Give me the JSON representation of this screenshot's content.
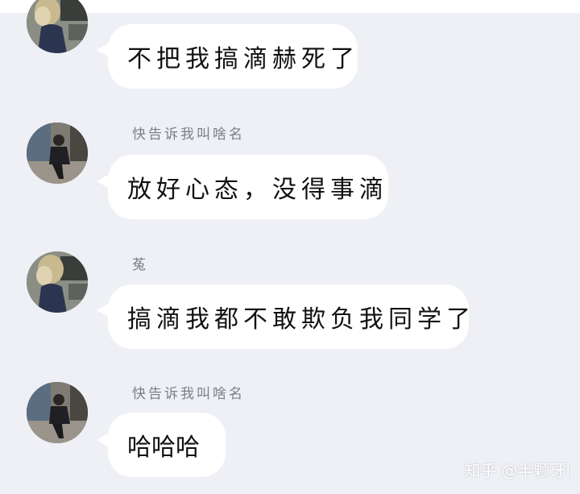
{
  "conversation": {
    "messages": [
      {
        "sender": "",
        "text": "不把我搞滴赫死了",
        "avatar_kind": "girl"
      },
      {
        "sender": "快告诉我叫啥名",
        "text": "放好心态，没得事滴",
        "avatar_kind": "boy"
      },
      {
        "sender": "菟",
        "text": "搞滴我都不敢欺负我同学了",
        "avatar_kind": "girl"
      },
      {
        "sender": "快告诉我叫啥名",
        "text": "哈哈哈",
        "avatar_kind": "boy"
      }
    ]
  },
  "watermark": "知乎 @半颗牙i",
  "colors": {
    "background": "#eef0f5",
    "bubble": "#ffffff",
    "sender_text": "#7b7f88",
    "message_text": "#111111"
  }
}
